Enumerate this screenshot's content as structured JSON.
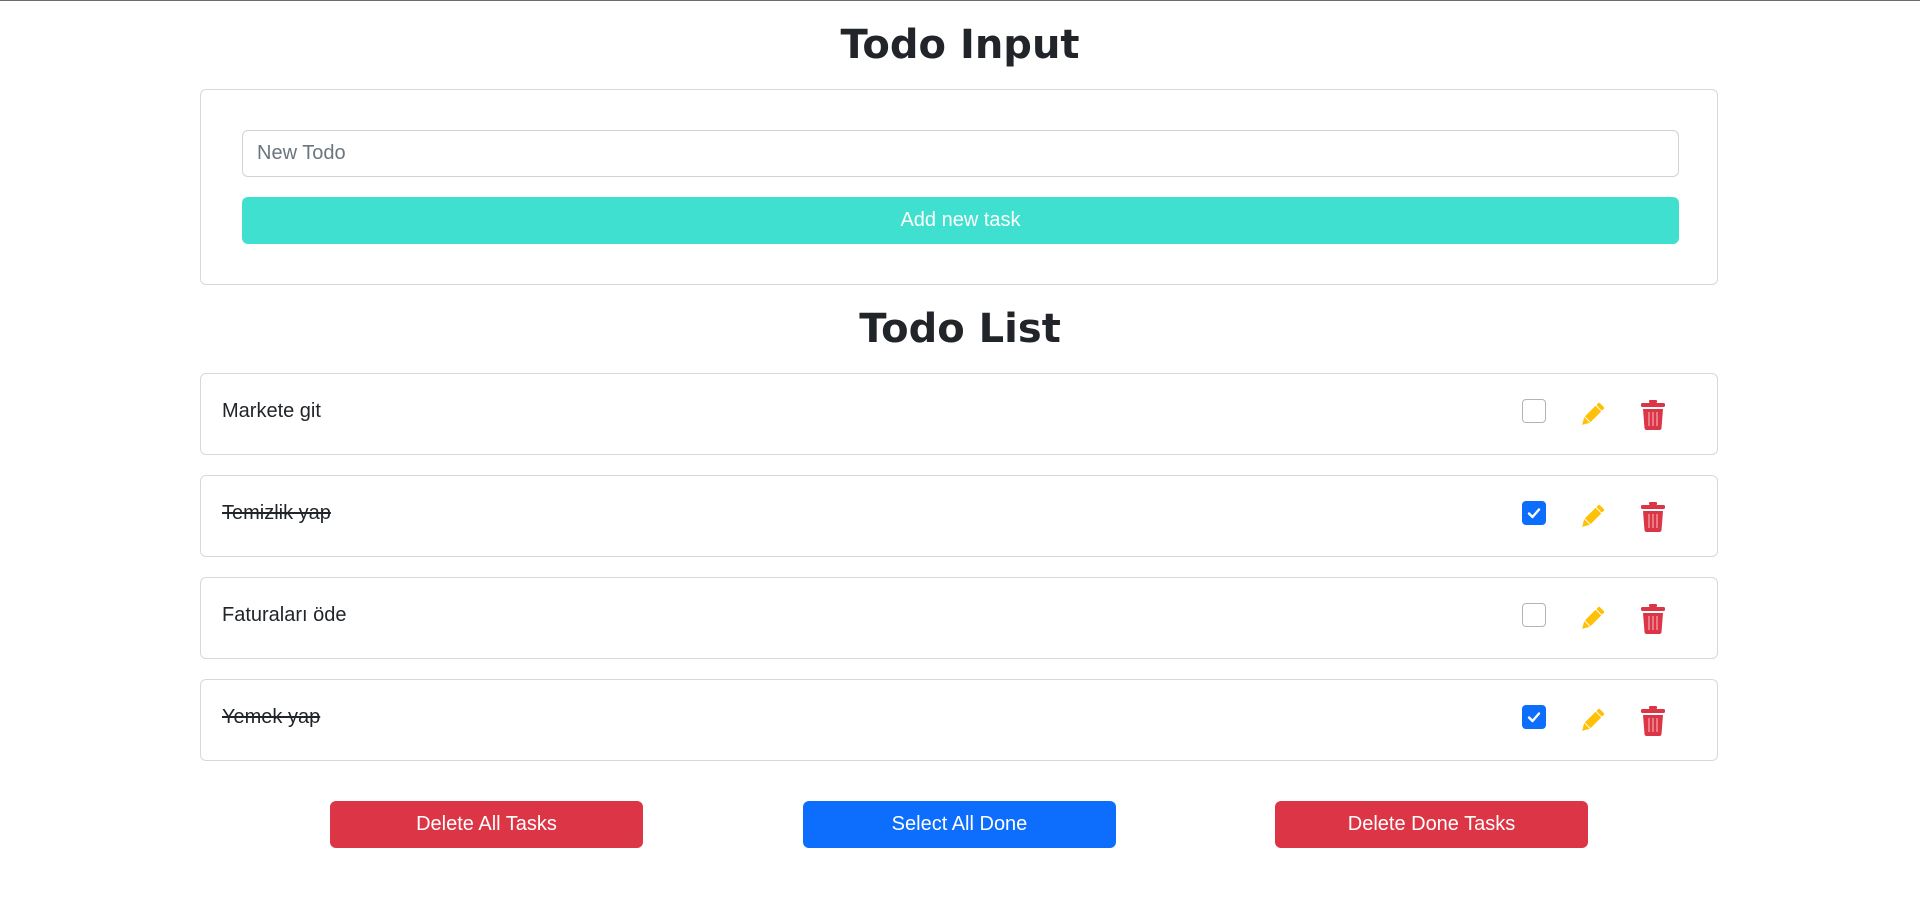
{
  "input_section": {
    "title": "Todo Input",
    "placeholder": "New Todo",
    "value": "",
    "add_button": "Add new task"
  },
  "list_section": {
    "title": "Todo List",
    "items": [
      {
        "text": "Markete git",
        "done": false
      },
      {
        "text": "Temizlik yap",
        "done": true
      },
      {
        "text": "Faturaları öde",
        "done": false
      },
      {
        "text": "Yemek yap",
        "done": true
      }
    ]
  },
  "actions": {
    "delete_all": "Delete All Tasks",
    "select_all_done": "Select All Done",
    "delete_done": "Delete Done Tasks"
  },
  "colors": {
    "add_button": "#40e0d0",
    "danger": "#dc3545",
    "primary": "#0d6efd",
    "edit_icon": "#ffc107",
    "trash_icon": "#dc3545"
  }
}
